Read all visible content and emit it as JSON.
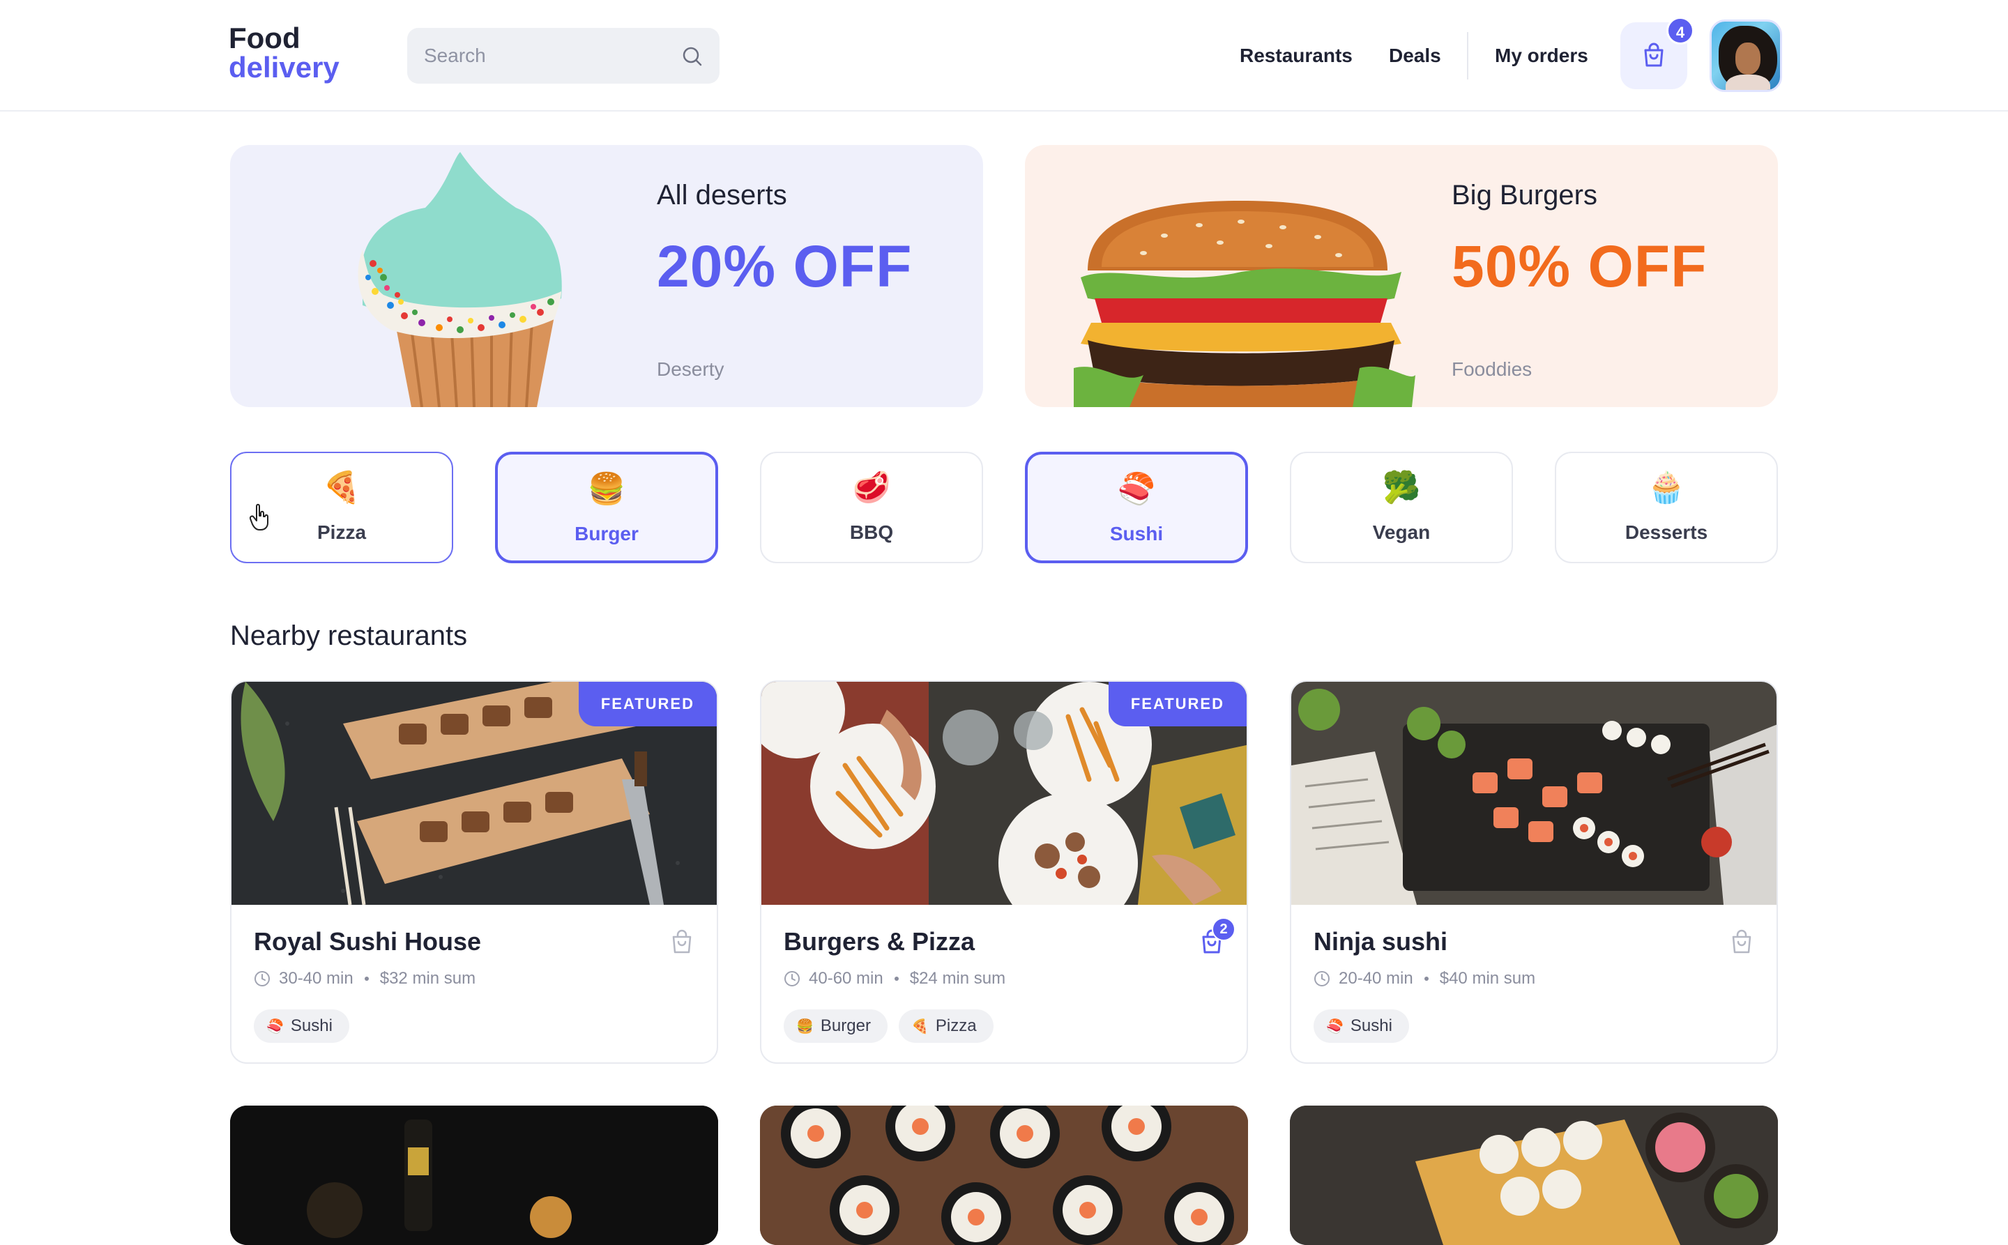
{
  "header": {
    "logo_line1": "Food",
    "logo_line2": "delivery",
    "search_placeholder": "Search",
    "nav": {
      "restaurants": "Restaurants",
      "deals": "Deals",
      "my_orders": "My orders"
    },
    "cart_count": "4"
  },
  "promos": [
    {
      "title": "All deserts",
      "offer": "20% OFF",
      "brand": "Deserty",
      "accent": "#5b5ef0"
    },
    {
      "title": "Big Burgers",
      "offer": "50% OFF",
      "brand": "Fooddies",
      "accent": "#f26b1d"
    }
  ],
  "categories": [
    {
      "label": "Pizza",
      "emoji": "🍕",
      "state": "hover"
    },
    {
      "label": "Burger",
      "emoji": "🍔",
      "state": "active"
    },
    {
      "label": "BBQ",
      "emoji": "🥩",
      "state": "default"
    },
    {
      "label": "Sushi",
      "emoji": "🍣",
      "state": "active"
    },
    {
      "label": "Vegan",
      "emoji": "🥦",
      "state": "default"
    },
    {
      "label": "Desserts",
      "emoji": "🧁",
      "state": "default"
    }
  ],
  "section_title": "Nearby restaurants",
  "restaurants": [
    {
      "name": "Royal Sushi House",
      "time": "30-40 min",
      "min_sum": "$32 min sum",
      "featured": "FEATURED",
      "tags": [
        {
          "emoji": "🍣",
          "label": "Sushi"
        }
      ]
    },
    {
      "name": "Burgers & Pizza",
      "time": "40-60 min",
      "min_sum": "$24 min sum",
      "featured": "FEATURED",
      "cart_count": "2",
      "tags": [
        {
          "emoji": "🍔",
          "label": "Burger"
        },
        {
          "emoji": "🍕",
          "label": "Pizza"
        }
      ]
    },
    {
      "name": "Ninja sushi",
      "time": "20-40 min",
      "min_sum": "$40 min sum",
      "tags": [
        {
          "emoji": "🍣",
          "label": "Sushi"
        }
      ]
    }
  ],
  "colors": {
    "accent": "#5b5ef0",
    "orange": "#f26b1d"
  }
}
